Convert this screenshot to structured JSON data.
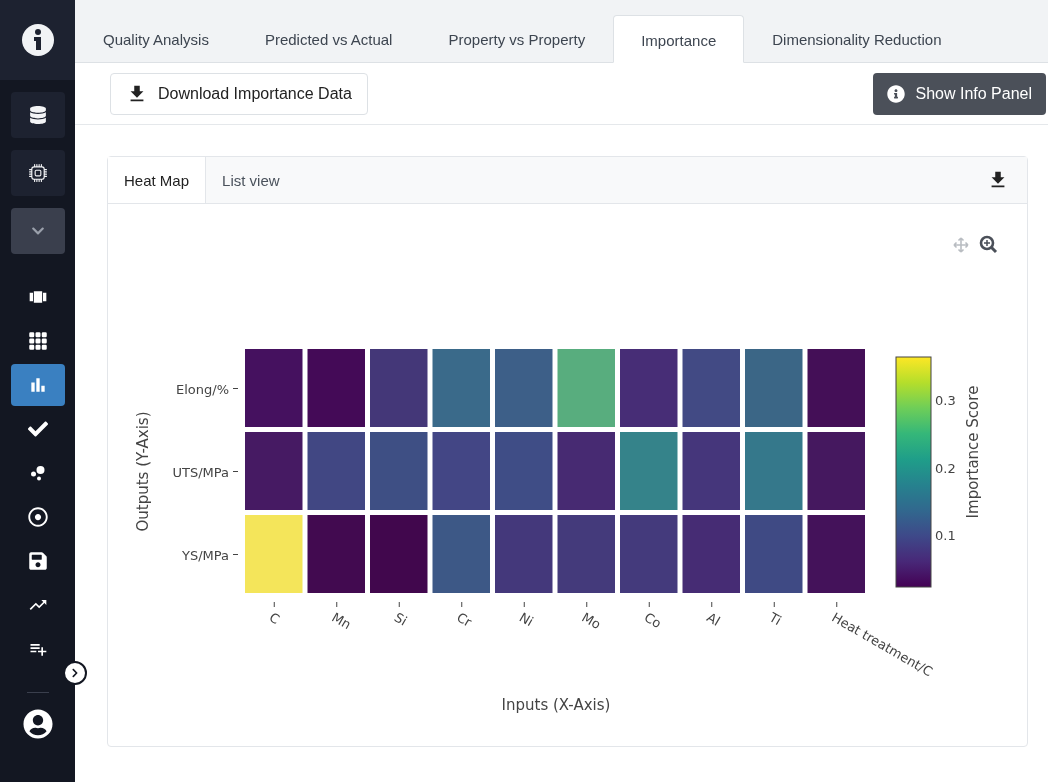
{
  "sidebar": {
    "items": [
      {
        "selected": false
      },
      {
        "selected": false
      },
      {
        "selected": true
      },
      {
        "selected": false
      },
      {
        "selected": false
      },
      {
        "selected": false
      },
      {
        "selected": false
      },
      {
        "selected": false
      },
      {
        "selected": false
      }
    ]
  },
  "tabs": [
    {
      "label": "Quality Analysis",
      "selected": false
    },
    {
      "label": "Predicted vs Actual",
      "selected": false
    },
    {
      "label": "Property vs Property",
      "selected": false
    },
    {
      "label": "Importance",
      "selected": true
    },
    {
      "label": "Dimensionality Reduction",
      "selected": false
    }
  ],
  "toolbar": {
    "download_button": "Download Importance Data",
    "info_button": "Show Info Panel"
  },
  "card": {
    "view_tabs": [
      {
        "label": "Heat Map",
        "selected": true
      },
      {
        "label": "List view",
        "selected": false
      }
    ],
    "heatmap": {
      "x_axis_title": "Inputs (X-Axis)",
      "y_axis_title": "Outputs (Y-Axis)",
      "columns": [
        "C",
        "Mn",
        "Si",
        "Cr",
        "Ni",
        "Mo",
        "Co",
        "Al",
        "Ti",
        "Heat treatment/C"
      ],
      "rows": [
        {
          "label": "Elong/%",
          "cells": [
            {
              "color": "#45115f"
            },
            {
              "color": "#440a57"
            },
            {
              "color": "#443778"
            },
            {
              "color": "#3a6a8a"
            },
            {
              "color": "#3d5f88"
            },
            {
              "color": "#58ad7e"
            },
            {
              "color": "#472d76"
            },
            {
              "color": "#424a84"
            },
            {
              "color": "#3b6686"
            },
            {
              "color": "#440f57"
            }
          ]
        },
        {
          "label": "UTS/MPa",
          "cells": [
            {
              "color": "#461a63"
            },
            {
              "color": "#414783"
            },
            {
              "color": "#3e4f84"
            },
            {
              "color": "#434685"
            },
            {
              "color": "#3f4d86"
            },
            {
              "color": "#472a72"
            },
            {
              "color": "#35838a"
            },
            {
              "color": "#45367b"
            },
            {
              "color": "#35788b"
            },
            {
              "color": "#45185f"
            }
          ]
        },
        {
          "label": "YS/MPa",
          "cells": [
            {
              "color": "#f4e55a"
            },
            {
              "color": "#420a50"
            },
            {
              "color": "#41074d"
            },
            {
              "color": "#3d5886"
            },
            {
              "color": "#44387b"
            },
            {
              "color": "#443a7b"
            },
            {
              "color": "#443a7c"
            },
            {
              "color": "#462c74"
            },
            {
              "color": "#3f4a84"
            },
            {
              "color": "#44125a"
            }
          ]
        }
      ],
      "colorbar": {
        "title": "Importance Score",
        "ticks": [
          "0.3",
          "0.2",
          "0.1"
        ]
      }
    }
  }
}
